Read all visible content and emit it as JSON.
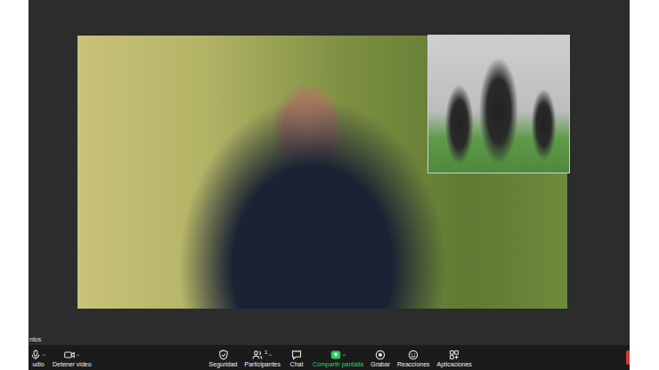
{
  "partial_label": "ntos",
  "toolbar_left": [
    {
      "label": "udio"
    },
    {
      "label": "Detener video"
    }
  ],
  "toolbar_center": [
    {
      "label": "Seguridad",
      "active": false
    },
    {
      "label": "Participantes",
      "count": "1",
      "active": false
    },
    {
      "label": "Chat",
      "active": false
    },
    {
      "label": "Compartir pantalla",
      "active": true
    },
    {
      "label": "Grabar",
      "active": false
    },
    {
      "label": "Reacciones",
      "active": false
    },
    {
      "label": "Aplicaciones",
      "active": false
    }
  ]
}
